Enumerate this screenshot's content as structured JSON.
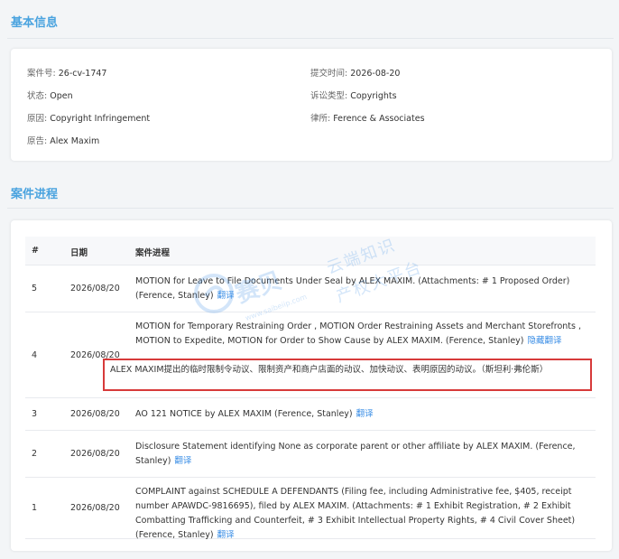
{
  "basic_info": {
    "title": "基本信息",
    "case_no_label": "案件号: ",
    "case_no": "26-cv-1747",
    "submit_time_label": "提交时间: ",
    "submit_time": "2026-08-20",
    "status_label": "状态: ",
    "status": "Open",
    "suit_type_label": "诉讼类型: ",
    "suit_type": "Copyrights",
    "cause_label": "原因: ",
    "cause": "Copyright Infringement",
    "law_firm_label": "律所: ",
    "law_firm": "Ference & Associates",
    "plaintiff_label": "原告: ",
    "plaintiff": "Alex Maxim"
  },
  "progress": {
    "title": "案件进程",
    "headers": {
      "num": "#",
      "date": "日期",
      "progress": "案件进程"
    },
    "rows": [
      {
        "num": "5",
        "date": "2026/08/20",
        "text": "MOTION for Leave to File Documents Under Seal by ALEX MAXIM. (Attachments: # 1 Proposed Order) (Ference, Stanley)",
        "action": "翻译"
      },
      {
        "num": "4",
        "date": "2026/08/20",
        "text": "MOTION for Temporary Restraining Order , MOTION Order Restraining Assets and Merchant Storefronts , MOTION to Expedite, MOTION for Order to Show Cause by ALEX MAXIM. (Ference, Stanley)",
        "action": "隐藏翻译",
        "translation": "ALEX MAXIM提出的临时限制令动议、限制资产和商户店面的动议、加快动议、表明原因的动议。（斯坦利·弗伦斯）"
      },
      {
        "num": "3",
        "date": "2026/08/20",
        "text": "AO 121 NOTICE by ALEX MAXIM (Ference, Stanley)",
        "action": "翻译"
      },
      {
        "num": "2",
        "date": "2026/08/20",
        "text": "Disclosure Statement identifying None as corporate parent or other affiliate by ALEX MAXIM. (Ference, Stanley)",
        "action": "翻译"
      },
      {
        "num": "1",
        "date": "2026/08/20",
        "text": "COMPLAINT against SCHEDULE A DEFENDANTS (Filing fee, including Administrative fee, $405, receipt number APAWDC-9816695), filed by ALEX MAXIM. (Attachments: # 1 Exhibit Registration, # 2 Exhibit Combatting Trafficking and Counterfeit, # 3 Exhibit Intellectual Property Rights, # 4 Civil Cover Sheet) (Ference, Stanley)",
        "action": "翻译"
      }
    ]
  },
  "watermark": {
    "brand": "赛贝",
    "url": "www.saibeiip.com",
    "slogan_line1": "云端知识",
    "slogan_line2": "产权大平台"
  },
  "colors": {
    "accent": "#4aa3df",
    "link": "#3a8ee6",
    "highlight_border": "#d73a3a"
  }
}
